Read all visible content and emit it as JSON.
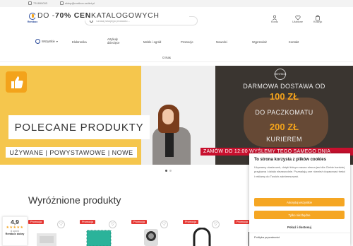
{
  "topbar": {
    "phone": "731890003",
    "email": "sklep@rentbox-outlet.pl"
  },
  "header": {
    "logo_text": "Rentbox",
    "search_placeholder": "Szukaj swojego produktu...",
    "icons": [
      {
        "label": "Konto",
        "icon": "user-icon"
      },
      {
        "label": "Ulubione",
        "icon": "heart-icon"
      },
      {
        "label": "Koszyk",
        "icon": "bag-icon"
      }
    ]
  },
  "nav": {
    "all_label": "Wszystkie",
    "items": [
      "Elektronika",
      "Artykuły dziecięce",
      "Meble i ogród",
      "Promocje",
      "Nowości",
      "Wyprzedaż",
      "Kontakt",
      "O Nas"
    ]
  },
  "banner": {
    "left_line1_prefix": "DO - ",
    "left_line1_bold": "70% CEN",
    "left_line1_suffix": " KATALOGOWYCH",
    "left_line2": "POLECANE PRODUKTY",
    "left_line3": "UŻYWANE | POWYSTAWOWE | NOWE",
    "right_logo": "RENTBOX",
    "right_line1": "DARMOWA DOSTAWA OD",
    "right_amount1": "100 ZŁ",
    "right_line2": "DO PACZKOMATU",
    "right_amount2": "200 ZŁ",
    "right_line3": "KURIEREM",
    "right_strip": "ZAMÓW DO 12:00 WYŚLEMY TEGO SAMEGO DNIA"
  },
  "section_title": "Wyróżnione produkty",
  "cards": [
    {
      "tag": "Promocja"
    },
    {
      "tag": "Promocja"
    },
    {
      "tag": "Promocja"
    },
    {
      "tag": "Promocja"
    },
    {
      "tag": "Promocja"
    }
  ],
  "rating": {
    "value": "4,9",
    "stars": "★★★★★",
    "count": "8 opinii",
    "name": "Rentbox dobry"
  },
  "cookie": {
    "title": "To strona korzysta z plików cookies",
    "text": "Używamy ciasteczek, dzięki którym nasza strona jest dla Ciebie bardziej przyjazna i działa niezawodnie. Pozwalają one również dopasować treści i reklamy do Twoich zainteresowań.",
    "accept_all": "Akceptuj wszystkie",
    "necessary_only": "Tylko niezbędne",
    "settings": "Pokaż i dostosuj",
    "privacy_link": "Polityka prywatności"
  },
  "colors": {
    "accent": "#f5a623",
    "brand": "#2a4a9a",
    "promo_red": "#e53935",
    "banner_yellow": "#f5c64d"
  }
}
